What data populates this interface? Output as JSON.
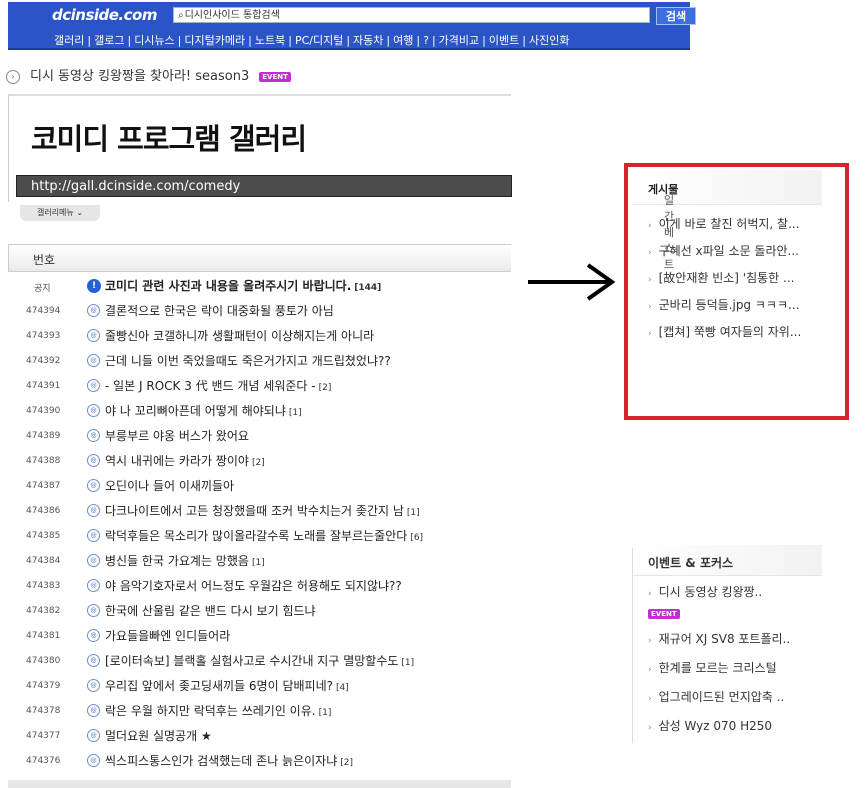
{
  "header": {
    "logo": "dcinside.com",
    "search_placeholder": "디시인사이드 통합검색",
    "search_button": "검색",
    "menu": [
      "갤러리",
      "갤로그",
      "디시뉴스",
      "디지털카메라",
      "노트북",
      "PC/디지털",
      "자동차",
      "여행",
      "?",
      "가격비교",
      "이벤트",
      "사진인화"
    ]
  },
  "event_banner": {
    "text": "디시 동영상 킹왕짱을 찾아라! season3",
    "badge": "EVENT"
  },
  "gallery": {
    "title": "코미디 프로그램 갤러리",
    "url": "http://gall.dcinside.com/comedy",
    "menu_button": "갤러리메뉴"
  },
  "table": {
    "header": "번호",
    "notice": {
      "num": "공지",
      "subject": "코미디 관련 사진과 내용을 올려주시기 바랍니다.",
      "count": "[144]"
    },
    "rows": [
      {
        "num": "474394",
        "subject": "결론적으로 한국은 락이 대중화될 풍토가 아님",
        "count": ""
      },
      {
        "num": "474393",
        "subject": "줄빵신아 코갤하니까 생활패턴이 이상해지는게 아니라",
        "count": ""
      },
      {
        "num": "474392",
        "subject": "근데 니들 이번 죽었을때도 죽은거가지고 개드립쳤었냐??",
        "count": ""
      },
      {
        "num": "474391",
        "subject": "- 일본 J ROCK 3 代 밴드 개념 세워준다 -",
        "count": "[2]"
      },
      {
        "num": "474390",
        "subject": "야 나 꼬리뼈아픈데 어떻게 해야되냐",
        "count": "[1]"
      },
      {
        "num": "474389",
        "subject": "부릉부르 야옹 버스가 왔어요",
        "count": ""
      },
      {
        "num": "474388",
        "subject": "역시 내귀에는 카라가 짱이야",
        "count": "[2]"
      },
      {
        "num": "474387",
        "subject": "오딘이나 들어 이새끼들아",
        "count": ""
      },
      {
        "num": "474386",
        "subject": "다크나이트에서 고든 청장했을때 조커 박수치는거 좆간지 남",
        "count": "[1]"
      },
      {
        "num": "474385",
        "subject": "락덕후들은 목소리가 많이올라갈수록 노래를 잘부르는줄안다",
        "count": "[6]"
      },
      {
        "num": "474384",
        "subject": "병신들 한국 가요계는 망했음",
        "count": "[1]"
      },
      {
        "num": "474383",
        "subject": "야 음악기호자로서 어느정도 우월감은 허용해도 되지않냐??",
        "count": ""
      },
      {
        "num": "474382",
        "subject": "한국에 산울림 같은 밴드 다시 보기 힘드냐",
        "count": ""
      },
      {
        "num": "474381",
        "subject": "가요들을빠엔 인디들어라",
        "count": ""
      },
      {
        "num": "474380",
        "subject": "[로이터속보] 블랙홀 실험사고로 수시간내 지구 멸망할수도",
        "count": "[1]"
      },
      {
        "num": "474379",
        "subject": "우리집 앞에서 좆고딩새끼들 6명이 담배피네?",
        "count": "[4]"
      },
      {
        "num": "474378",
        "subject": "락은 우월 하지만 락덕후는 쓰레기인 이유.",
        "count": "[1]"
      },
      {
        "num": "474377",
        "subject": "멀더요원 실명공개 ★",
        "count": ""
      },
      {
        "num": "474376",
        "subject": "씩스피스통스인가 검색했는데 존나 늙은이자냐",
        "count": "[2]"
      }
    ]
  },
  "sidebar": {
    "best_title_prefix": "일간 베스트",
    "best_title_bold": "게시물",
    "best_items": [
      "이게 바로 찰진 허벅지, 찰...",
      "구혜선 x파일 소문 돌라안...",
      "[故안재환 빈소] '침통한 ...",
      "군바리 등덕들.jpg ㅋㅋㅋ...",
      "[캡쳐] 쭉빵 여자들의 자위..."
    ],
    "events_title": "이벤트 & 포커스",
    "event_items": [
      {
        "text": "디시 동영상 킹왕짱..",
        "badge": "EVENT"
      },
      {
        "text": "재규어 XJ SV8 포트폴리..",
        "badge": ""
      },
      {
        "text": "한계를 모르는 크리스털",
        "badge": ""
      },
      {
        "text": "업그레이드된 먼지압축 ..",
        "badge": ""
      },
      {
        "text": "삼성 Wyz 070 H250",
        "badge": ""
      }
    ]
  }
}
